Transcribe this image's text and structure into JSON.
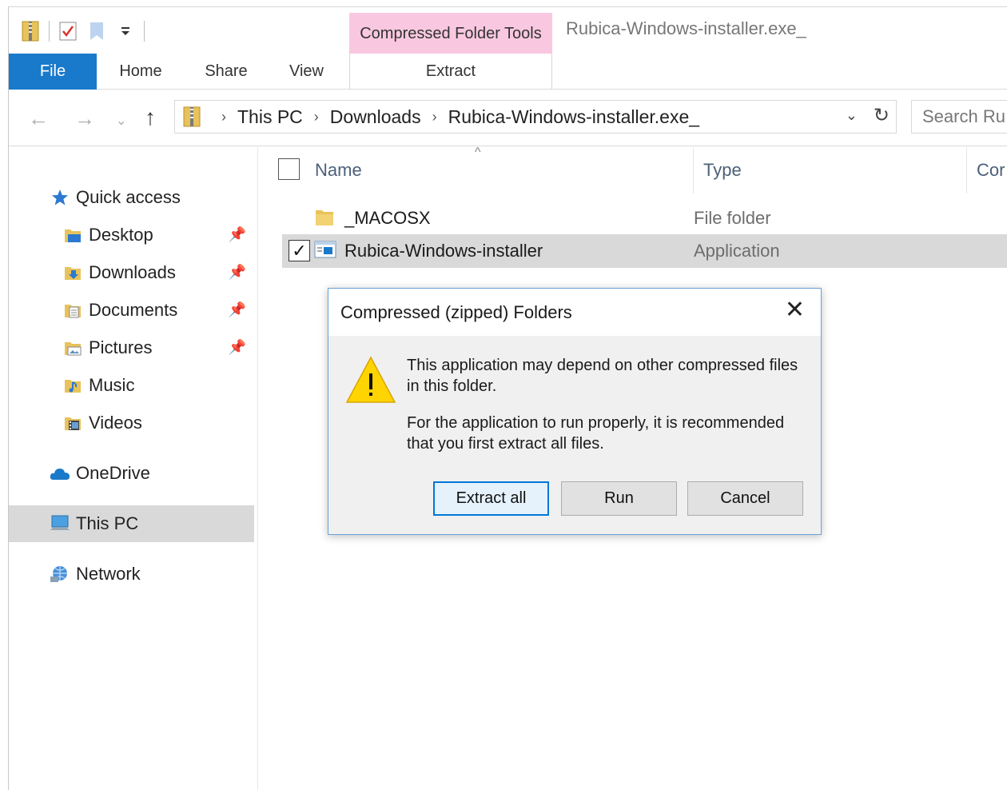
{
  "window": {
    "title": "Rubica-Windows-installer.exe_",
    "context_tab_title": "Compressed Folder Tools",
    "context_tab_color": "#f9c8e0"
  },
  "ribbon": {
    "tabs": [
      "File",
      "Home",
      "Share",
      "View",
      "Extract"
    ],
    "file_tab_color": "#1979ca"
  },
  "address": {
    "crumbs": [
      "This PC",
      "Downloads",
      "Rubica-Windows-installer.exe_"
    ],
    "search_placeholder": "Search Ru"
  },
  "nav": {
    "quick_access": "Quick access",
    "items": [
      {
        "label": "Desktop",
        "icon": "desktop-folder-icon",
        "pinned": true
      },
      {
        "label": "Downloads",
        "icon": "downloads-folder-icon",
        "pinned": true
      },
      {
        "label": "Documents",
        "icon": "documents-folder-icon",
        "pinned": true
      },
      {
        "label": "Pictures",
        "icon": "pictures-folder-icon",
        "pinned": true
      },
      {
        "label": "Music",
        "icon": "music-folder-icon",
        "pinned": false
      },
      {
        "label": "Videos",
        "icon": "videos-folder-icon",
        "pinned": false
      }
    ],
    "onedrive": "OneDrive",
    "this_pc": "This PC",
    "network": "Network"
  },
  "columns": {
    "name": "Name",
    "type": "Type",
    "compressed": "Cor"
  },
  "files": [
    {
      "name": "_MACOSX",
      "type": "File folder",
      "checked": false,
      "selected": false
    },
    {
      "name": "Rubica-Windows-installer",
      "type": "Application",
      "checked": true,
      "selected": true
    }
  ],
  "dialog": {
    "title": "Compressed (zipped) Folders",
    "message1": "This application may depend on other compressed files in this folder.",
    "message2": "For the application to run properly, it is recommended that you first extract all files.",
    "buttons": {
      "extract_all": "Extract all",
      "run": "Run",
      "cancel": "Cancel"
    }
  }
}
